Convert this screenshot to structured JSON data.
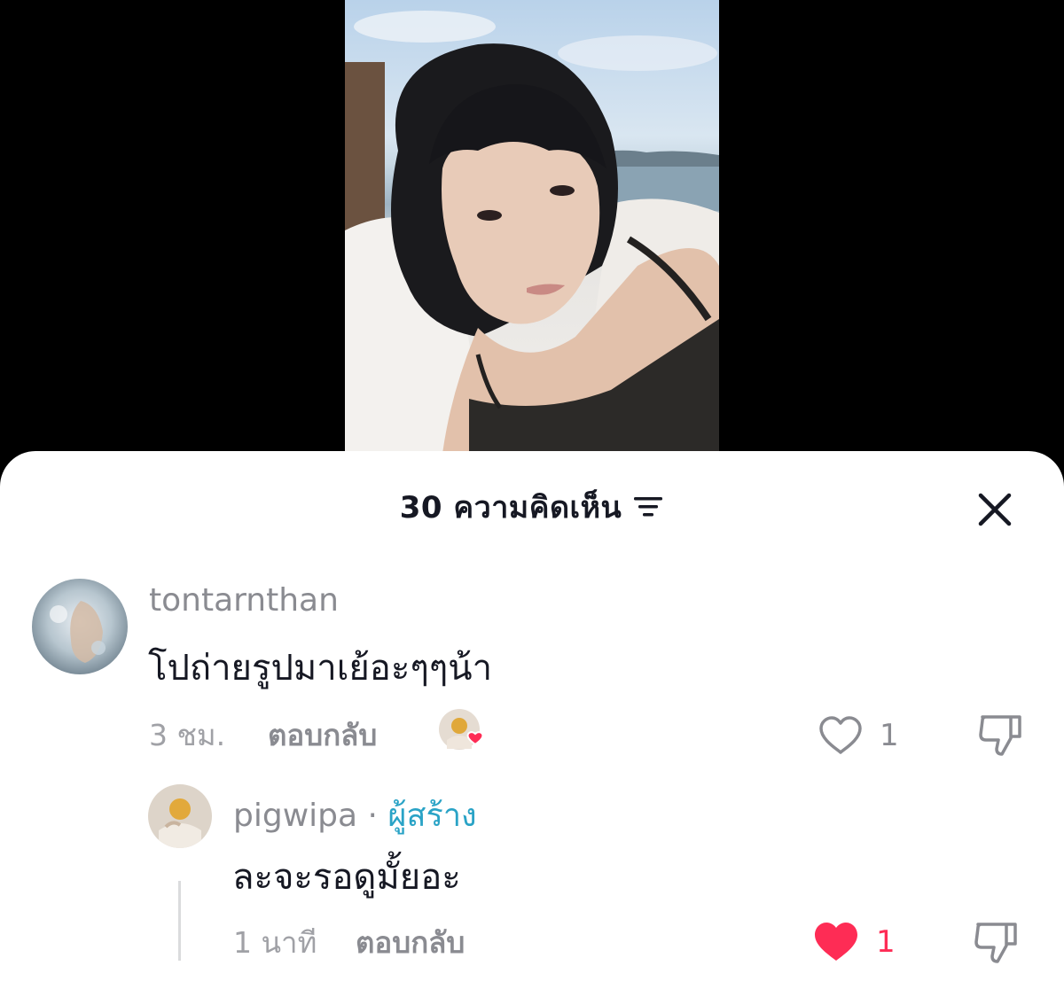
{
  "sheet": {
    "comment_count": "30",
    "title_suffix": "ความคิดเห็น"
  },
  "icons": {
    "filter": "filter-lines-icon",
    "close": "close-icon",
    "like": "heart-icon",
    "dislike": "thumbs-down-icon"
  },
  "colors": {
    "accent_like": "#fe2c55",
    "creator_tag": "#2aa3c6",
    "text_primary": "#161823",
    "text_secondary": "#8a8b91"
  },
  "comments": [
    {
      "username": "tontarnthan",
      "text": "โปถ่ายรูปมาเย้อะๆๆน้า",
      "time": "3 ชม.",
      "reply_label": "ตอบกลับ",
      "like_count": "1",
      "liked": false,
      "creator_liked": true
    }
  ],
  "replies": [
    {
      "username": "pigwipa",
      "separator": "·",
      "creator_label": "ผู้สร้าง",
      "text": "ละจะรอดูมั้ยอะ",
      "time": "1 นาที",
      "reply_label": "ตอบกลับ",
      "like_count": "1",
      "liked": true
    }
  ]
}
